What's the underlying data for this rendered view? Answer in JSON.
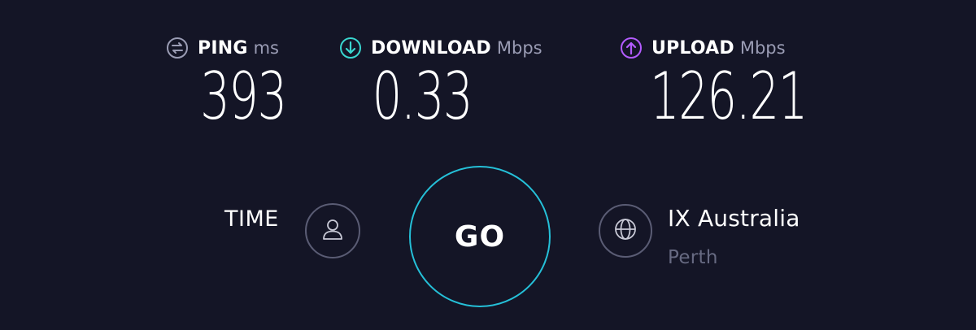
{
  "metrics": {
    "ping": {
      "label": "PING",
      "unit": "ms",
      "value": "393",
      "icon": "ping-icon",
      "color": "#9a9cb4"
    },
    "download": {
      "label": "DOWNLOAD",
      "unit": "Mbps",
      "value": "0.33",
      "icon": "download-arrow-icon",
      "color": "#39d6cf"
    },
    "upload": {
      "label": "UPLOAD",
      "unit": "Mbps",
      "value": "126.21",
      "icon": "upload-arrow-icon",
      "color": "#b35cff"
    }
  },
  "time": {
    "label": "TIME",
    "icon": "user-icon"
  },
  "go_button": {
    "label": "GO",
    "ring_color": "#25c0d8"
  },
  "server": {
    "name": "IX Australia",
    "city": "Perth",
    "icon": "globe-icon"
  },
  "colors": {
    "background": "#141526",
    "text": "#ffffff",
    "muted": "#9a9cb4"
  }
}
